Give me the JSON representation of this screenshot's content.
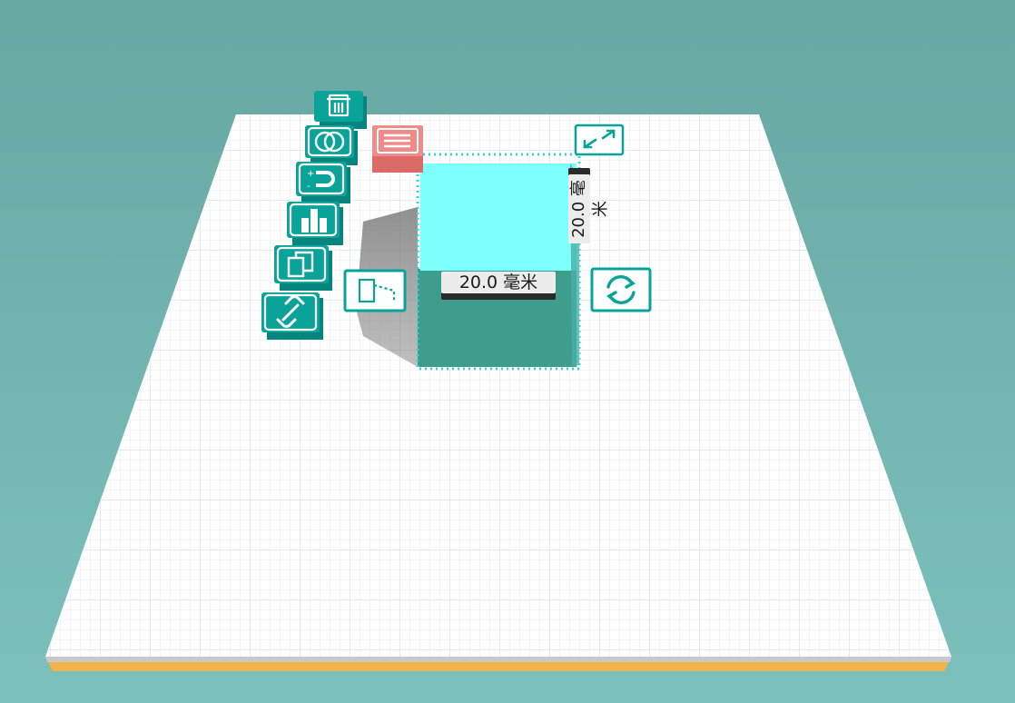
{
  "colors": {
    "background": "#6fafab",
    "plate": "#ffffff",
    "grid_line": "#d3d8e6",
    "plate_edge": "#f0b44a",
    "tool_face": "#0aa39a",
    "tool_dark": "#06857e",
    "menu_button": "#e77b78",
    "cube_top": "#7dfffb",
    "cube_front": "#3f9d8e",
    "selection_outline": "#38d6d1"
  },
  "object": {
    "name": "cube",
    "width_label": "20.0 毫米",
    "height_label": "20.0 毫米"
  },
  "toolbar": {
    "tools": [
      {
        "name": "delete",
        "icon": "trash-icon"
      },
      {
        "name": "boolean",
        "icon": "intersect-circles-icon"
      },
      {
        "name": "magnet",
        "icon": "magnet-icon"
      },
      {
        "name": "align",
        "icon": "align-icon"
      },
      {
        "name": "duplicate",
        "icon": "duplicate-icon"
      },
      {
        "name": "group",
        "icon": "link-icon"
      }
    ],
    "menu_icon": "menu-lines-icon",
    "mirror_icon": "mirror-plane-icon",
    "scale_icon": "scale-arrows-icon",
    "rotate_icon": "rotate-arrows-icon"
  }
}
